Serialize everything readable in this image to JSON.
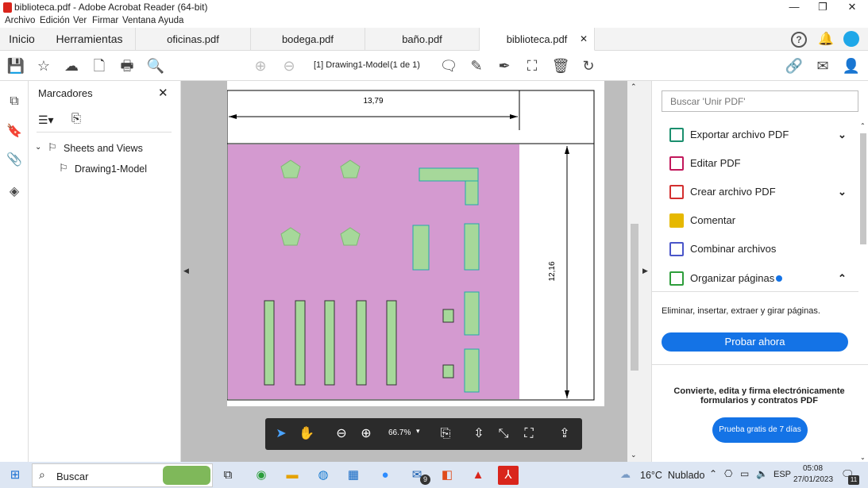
{
  "window": {
    "title": "biblioteca.pdf - Adobe Acrobat Reader (64-bit)"
  },
  "menu": [
    "Archivo",
    "Edición",
    "Ver",
    "Firmar",
    "Ventana",
    "Ayuda"
  ],
  "tabs": {
    "home": "Inicio",
    "tools": "Herramientas",
    "docs": [
      "oficinas.pdf",
      "bodega.pdf",
      "baño.pdf",
      "biblioteca.pdf"
    ],
    "active": "biblioteca.pdf"
  },
  "toolbar": {
    "page_label": "[1] Drawing1-Model",
    "page_count": "(1 de 1)"
  },
  "bookmarks": {
    "title": "Marcadores",
    "items": [
      {
        "label": "Sheets and Views"
      },
      {
        "label": "Drawing1-Model"
      }
    ]
  },
  "drawing": {
    "width_dim": "13,79",
    "height_dim": "12,16"
  },
  "floatbar": {
    "zoom": "66.7%"
  },
  "rightpanel": {
    "search_placeholder": "Buscar 'Unir PDF'",
    "tools": [
      {
        "label": "Exportar archivo PDF",
        "color": "#1b8f6e"
      },
      {
        "label": "Editar PDF",
        "color": "#c2185b"
      },
      {
        "label": "Crear archivo PDF",
        "color": "#d32f2f"
      },
      {
        "label": "Comentar",
        "color": "#e6b800"
      },
      {
        "label": "Combinar archivos",
        "color": "#4a56c9"
      },
      {
        "label": "Organizar páginas",
        "color": "#2e9e3c"
      }
    ],
    "organize_desc": "Eliminar, insertar, extraer y girar páginas.",
    "try_now": "Probar ahora",
    "promo": "Convierte, edita y firma electrónicamente formularios y contratos PDF",
    "trial": "Prueba gratis de 7 días",
    "accent": "#1473e6"
  },
  "taskbar": {
    "search": "Buscar",
    "weather": "16°C  Nublado",
    "lang": "ESP",
    "time": "05:08",
    "date": "27/01/2023",
    "notif": "11",
    "mail_badge": "9"
  }
}
